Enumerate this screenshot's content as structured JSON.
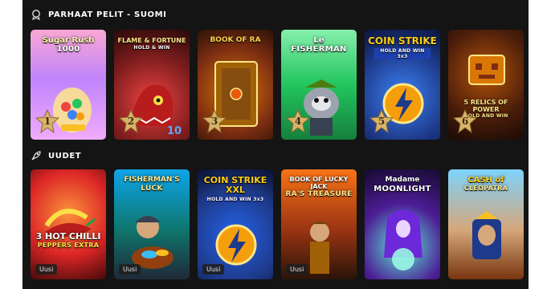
{
  "sections": {
    "top": {
      "title": "PARHAAT PELIT - SUOMI",
      "icon": "trophy-icon",
      "games": [
        {
          "title": "Sugar Rush",
          "sub": "1000",
          "rank": "1",
          "color": "#f9a8d4"
        },
        {
          "title": "FLAME & FORTUNE",
          "sub": "HOLD & WIN",
          "rank": "2",
          "color": "#b91c1c"
        },
        {
          "title": "BOOK OF RA",
          "sub": "",
          "rank": "3",
          "color": "#92400e"
        },
        {
          "title": "Le",
          "sub": "FISHERMAN",
          "rank": "4",
          "color": "#16a34a"
        },
        {
          "title": "COIN STRIKE",
          "sub": "HOLD AND WIN 3x3",
          "rank": "5",
          "color": "#1d4ed8"
        },
        {
          "title": "5 RELICS OF POWER",
          "sub": "HOLD AND WIN",
          "rank": "6",
          "color": "#b45309"
        }
      ]
    },
    "new": {
      "title": "UUDET",
      "icon": "rocket-icon",
      "badge": "Uusi",
      "games": [
        {
          "title": "3 HOT CHILLI",
          "sub": "PEPPERS EXTRA"
        },
        {
          "title": "FISHERMAN'S",
          "sub": "LUCK"
        },
        {
          "title": "COIN STRIKE XXL",
          "sub": "HOLD AND WIN 3x3"
        },
        {
          "title": "BOOK OF LUCKY JACK",
          "sub": "RA'S TREASURE"
        },
        {
          "title": "Madame",
          "sub": "MOONLIGHT"
        },
        {
          "title": "CASH of",
          "sub": "CLEOPATRA"
        }
      ]
    }
  }
}
